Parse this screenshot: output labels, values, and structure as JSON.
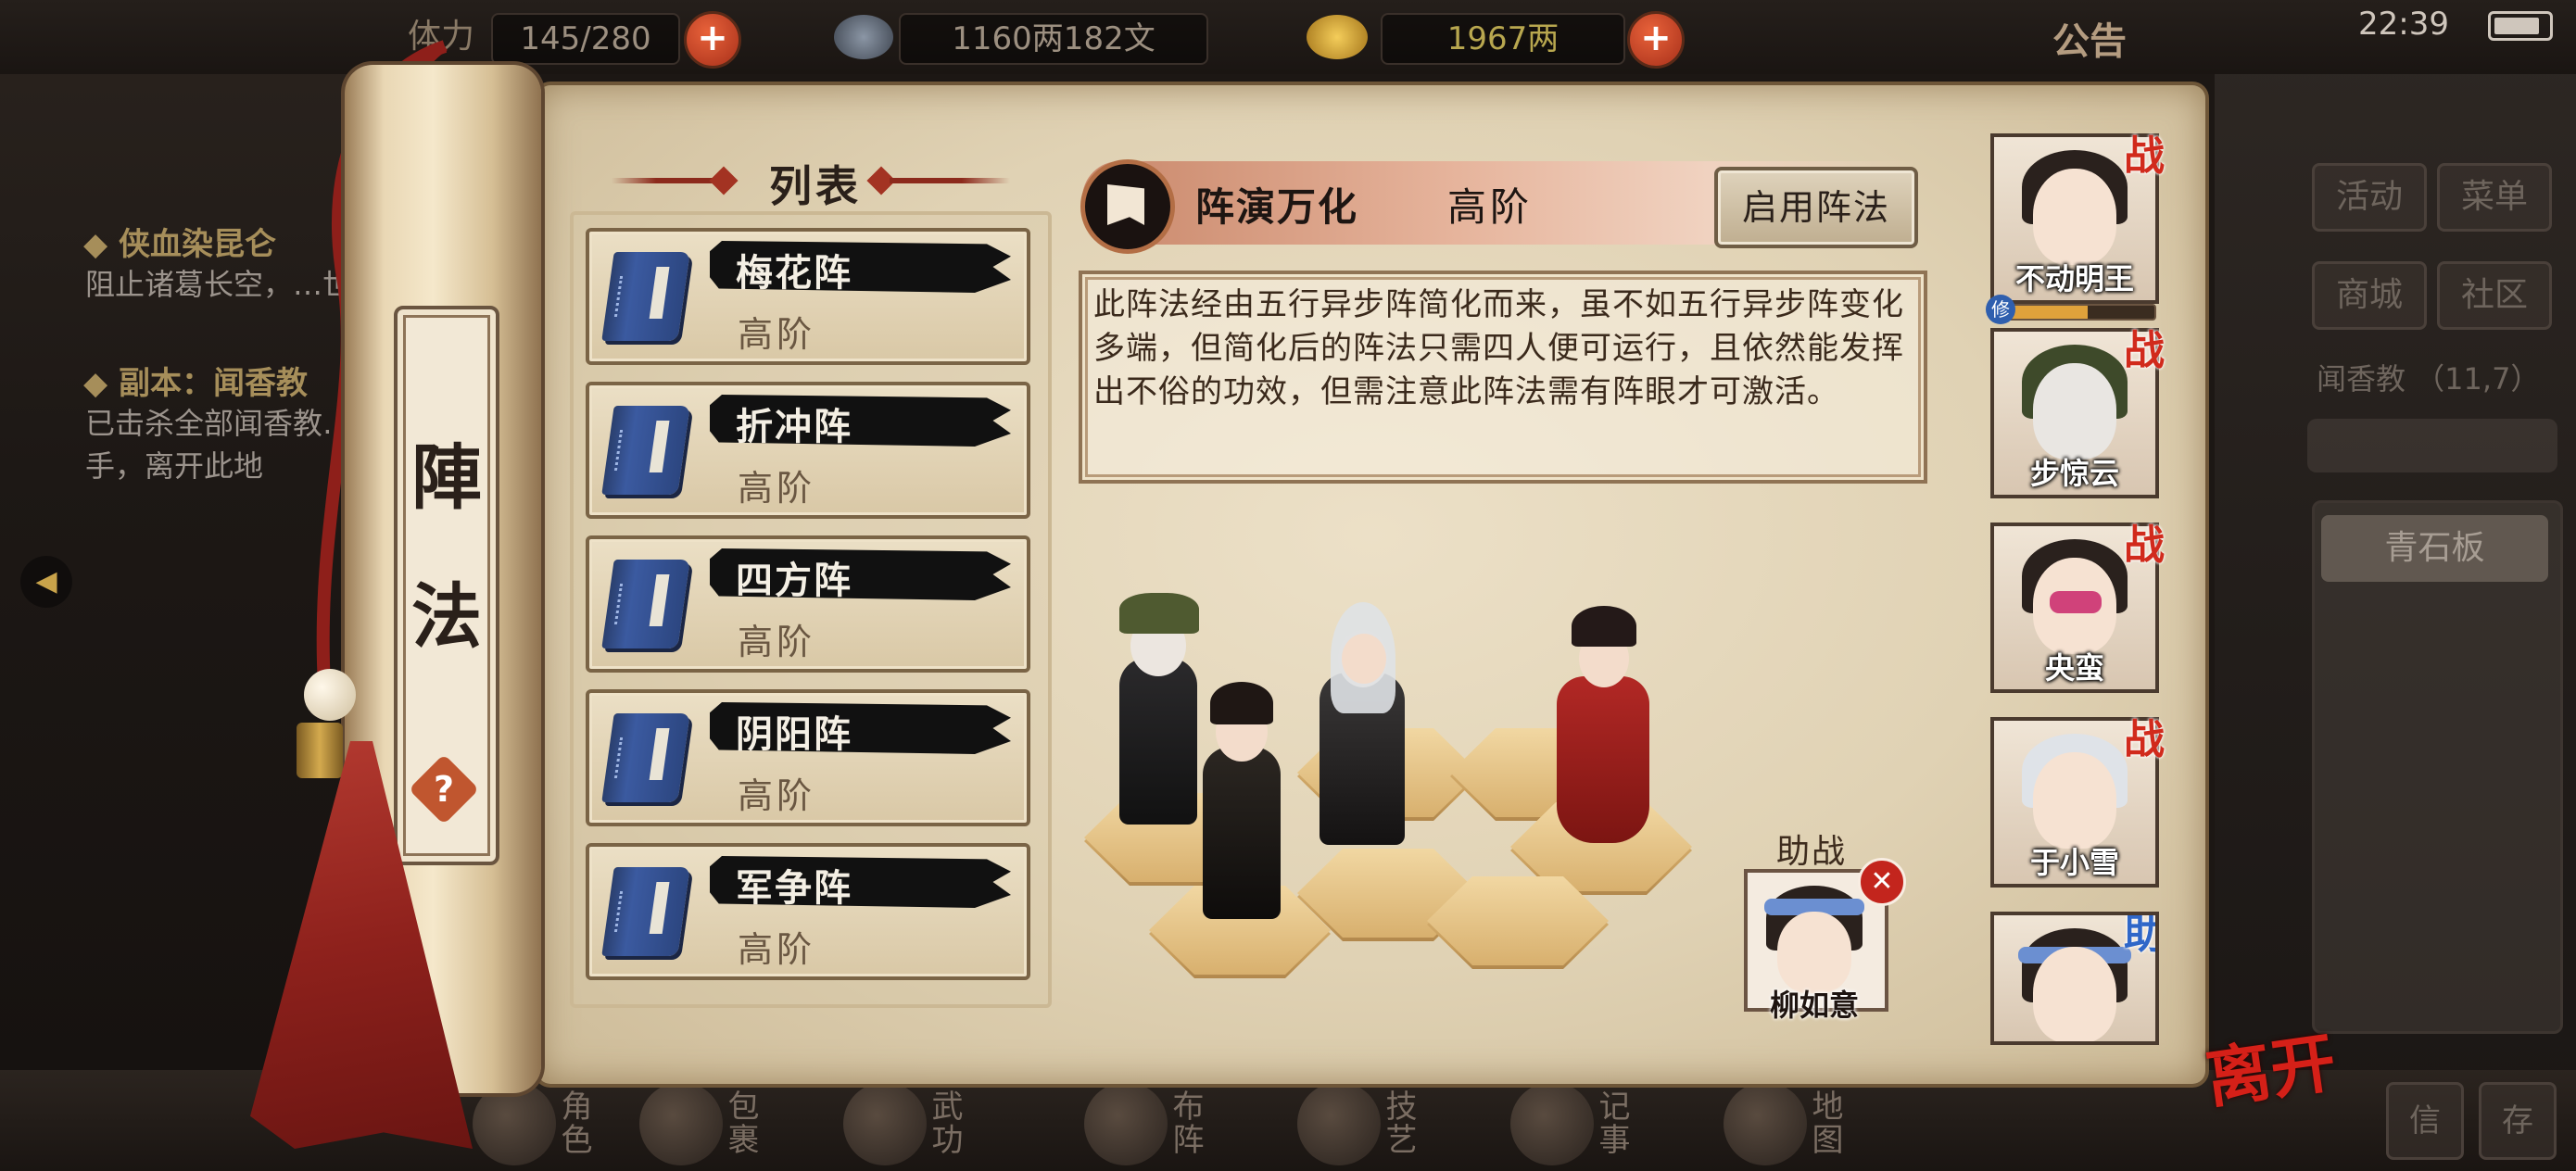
{
  "status_bar": {
    "stamina": "145/280",
    "stamina_label": "体力",
    "money": "1160两182文",
    "gold": "1967两",
    "notice": "公告",
    "time": "22:39"
  },
  "quest_panel": {
    "quest1_title": "◆ 侠血染昆仑",
    "quest1_desc": "阻止诸葛长空，…世",
    "quest2_title": "◆ 副本：闻香教",
    "quest2_desc": "已击杀全部闻香教…手，离开此地"
  },
  "side_menu": {
    "activity": "活动",
    "menu": "菜单",
    "mall": "商城",
    "community": "社区",
    "area": "闻香教 （11,7）",
    "stone": "青石板"
  },
  "scroll": {
    "title_char_1": "陣",
    "title_char_2": "法",
    "help": "?"
  },
  "list": {
    "header": "列表",
    "items": [
      {
        "name": "梅花阵",
        "tier": "高阶"
      },
      {
        "name": "折冲阵",
        "tier": "高阶"
      },
      {
        "name": "四方阵",
        "tier": "高阶"
      },
      {
        "name": "阴阳阵",
        "tier": "高阶"
      },
      {
        "name": "军争阵",
        "tier": "高阶"
      }
    ]
  },
  "formation": {
    "name": "阵演万化",
    "tier": "高阶",
    "activate_label": "启用阵法",
    "description": "此阵法经由五行异步阵简化而来，虽不如五行异步阵变化多端，但简化后的阵法只需四人便可运行，且依然能发挥出不俗的功效，但需注意此阵法需有阵眼才可激活。"
  },
  "assist": {
    "label": "助战",
    "name": "柳如意",
    "close": "✕"
  },
  "heroes": [
    {
      "name": "不动明王",
      "tag": "战"
    },
    {
      "name": "步惊云",
      "tag": "战"
    },
    {
      "name": "央蛮",
      "tag": "战"
    },
    {
      "name": "于小雪",
      "tag": "战"
    },
    {
      "name": "",
      "tag": "助"
    }
  ],
  "hero_xp_badge": "修",
  "bottom_nav": [
    "角色",
    "包裹",
    "武功",
    "布阵",
    "技艺",
    "记事",
    "地图"
  ],
  "exit_label": "离开",
  "corner_buttons": [
    "信",
    "存"
  ],
  "colors": {
    "accent_red": "#c0562f",
    "ink_black": "#111111",
    "parchment": "#e0d2b4",
    "book_blue": "#3b5aa0"
  }
}
